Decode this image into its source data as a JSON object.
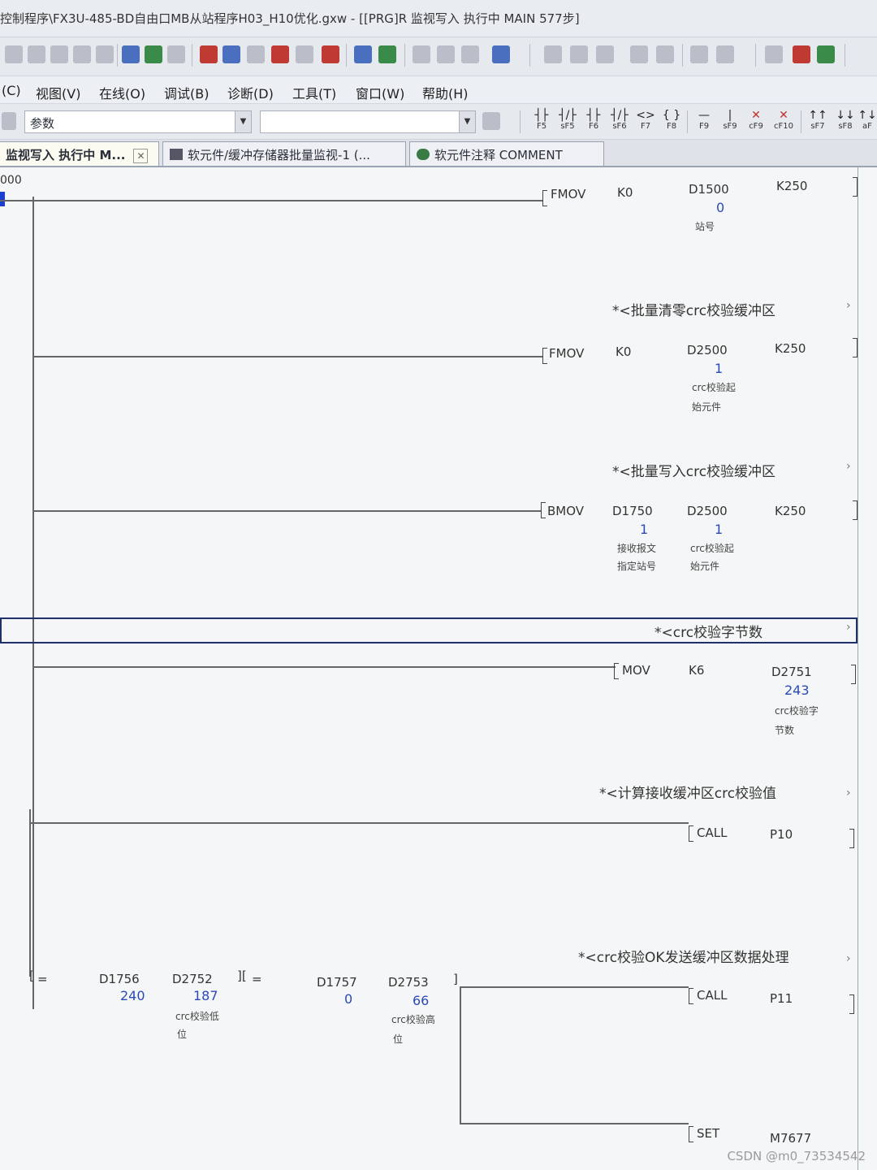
{
  "window": {
    "title": "控制程序\\FX3U-485-BD自由口MB从站程序H03_H10优化.gxw - [[PRG]R 监视写入 执行中 MAIN 577步]"
  },
  "menubar": {
    "items": [
      "(C)",
      "视图(V)",
      "在线(O)",
      "调试(B)",
      "诊断(D)",
      "工具(T)",
      "窗口(W)",
      "帮助(H)"
    ]
  },
  "toolbar2": {
    "param_label": "参数",
    "fkeys": [
      {
        "sym": "┤├",
        "label": "F5"
      },
      {
        "sym": "┤/├",
        "label": "sF5"
      },
      {
        "sym": "┤├",
        "label": "F6"
      },
      {
        "sym": "┤/├",
        "label": "sF6"
      },
      {
        "sym": "<>",
        "label": "F7"
      },
      {
        "sym": "{ }",
        "label": "F8"
      },
      {
        "sym": "—",
        "label": "F9"
      },
      {
        "sym": "|",
        "label": "sF9"
      },
      {
        "sym": "✕",
        "label": "cF9"
      },
      {
        "sym": "✕",
        "label": "cF10"
      },
      {
        "sym": "↑↑",
        "label": "sF7"
      },
      {
        "sym": "↓↓",
        "label": "sF8"
      },
      {
        "sym": "↑↓",
        "label": "aF"
      }
    ]
  },
  "tabs": [
    {
      "label": "监视写入 执行中 M...",
      "close": "✕"
    },
    {
      "label": "软元件/缓冲存储器批量监视-1 (..."
    },
    {
      "label": "软元件注释 COMMENT"
    }
  ],
  "ladder": {
    "step_no": "000",
    "rungs": [
      {
        "op": "FMOV",
        "a": "K0",
        "dev": "D1500",
        "dev_val": "0",
        "dev_cmt": [
          "站号"
        ],
        "n": "K250"
      },
      {
        "stmt": "*<批量清零crc校验缓冲区",
        "op": "FMOV",
        "a": "K0",
        "dev": "D2500",
        "dev_val": "1",
        "dev_cmt": [
          "crc校验起",
          "始元件"
        ],
        "n": "K250"
      },
      {
        "stmt": "*<批量写入crc校验缓冲区",
        "op": "BMOV",
        "a": "D1750",
        "a_val": "1",
        "a_cmt": [
          "接收报文",
          "指定站号"
        ],
        "dev": "D2500",
        "dev_val": "1",
        "dev_cmt": [
          "crc校验起",
          "始元件"
        ],
        "n": "K250"
      },
      {
        "stmt": "*<crc校验字节数",
        "op": "MOV",
        "a": "K6",
        "dev": "D2751",
        "dev_val": "243",
        "dev_cmt": [
          "crc校验字",
          "节数"
        ]
      },
      {
        "stmt": "*<计算接收缓冲区crc校验值",
        "op": "CALL",
        "dev": "P10"
      },
      {
        "stmt": "*<crc校验OK发送缓冲区数据处理",
        "cmp1": {
          "op": "=",
          "s1": "D1756",
          "s1_val": "240",
          "s2": "D2752",
          "s2_val": "187",
          "s2_cmt": [
            "crc校验低",
            "位"
          ]
        },
        "cmp2": {
          "op": "=",
          "s1": "D1757",
          "s1_val": "0",
          "s2": "D2753",
          "s2_val": "66",
          "s2_cmt": [
            "crc校验高",
            "位"
          ]
        },
        "out1": {
          "op": "CALL",
          "dev": "P11"
        },
        "out2": {
          "op": "SET",
          "dev": "M7677"
        }
      }
    ]
  },
  "watermark": "CSDN @m0_73534542",
  "colors": {
    "monitor_value": "#2a4ab8",
    "statement_box": "#20306a",
    "cursor": "#1a3fd0"
  }
}
